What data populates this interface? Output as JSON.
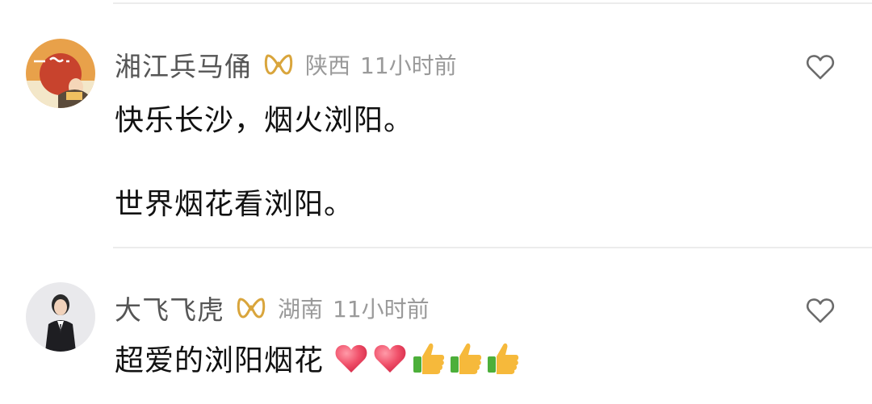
{
  "comments": [
    {
      "username": "湘江兵马俑",
      "location": "陕西",
      "time": "11小时前",
      "lines": [
        "快乐长沙，烟火浏阳。",
        "世界烟花看浏阳。"
      ],
      "avatar": "avatar-illustration-orange",
      "vip_badge": "vip-icon",
      "like_icon": "heart-outline-icon"
    },
    {
      "username": "大飞飞虎",
      "location": "湖南",
      "time": "11小时前",
      "lines": [
        "超爱的浏阳烟花"
      ],
      "emojis": [
        "red-heart",
        "red-heart",
        "thumbs-up",
        "thumbs-up",
        "thumbs-up"
      ],
      "avatar": "avatar-person-suit",
      "vip_badge": "vip-icon",
      "like_icon": "heart-outline-icon"
    }
  ],
  "colors": {
    "username": "#555555",
    "meta": "#9a9a9a",
    "body_text": "#111111",
    "vip_gold": "#d9a53c",
    "divider": "#ececec"
  }
}
